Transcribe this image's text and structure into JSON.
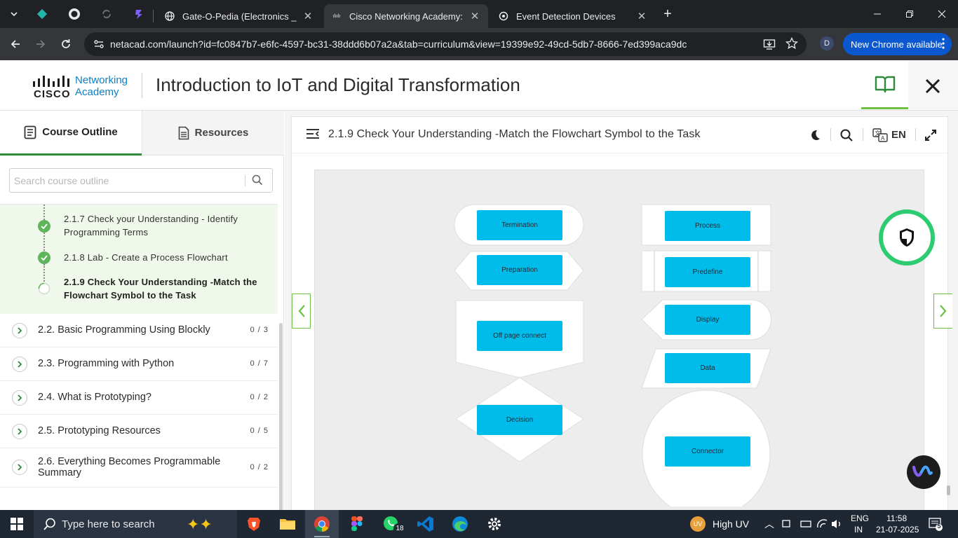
{
  "browser": {
    "tabs": [
      {
        "title": "Gate-O-Pedia (Electronics _ Con",
        "active": false
      },
      {
        "title": "Cisco Networking Academy: Intr",
        "active": true
      },
      {
        "title": "Event Detection Devices",
        "active": false
      }
    ],
    "url": "netacad.com/launch?id=fc0847b7-e6fc-4597-bc31-38ddd6b07a2a&tab=curriculum&view=19399e92-49cd-5db7-8666-7ed399aca9dc",
    "profile_initial": "D",
    "update_button": "New Chrome available"
  },
  "header": {
    "logo_brand": "CISCO",
    "logo_line1": "Networking",
    "logo_line2": "Academy",
    "course_title": "Introduction to IoT and Digital Transformation"
  },
  "sidebar": {
    "tabs": {
      "outline": "Course Outline",
      "resources": "Resources"
    },
    "search_placeholder": "Search course outline",
    "sub_items": [
      {
        "label": "2.1.7 Check your Understanding - Identify Programming Terms",
        "status": "complete"
      },
      {
        "label": "2.1.8 Lab - Create a Process Flowchart",
        "status": "complete"
      },
      {
        "label": "2.1.9 Check Your Understanding -Match the Flowchart Symbol to the Task",
        "status": "current"
      }
    ],
    "sections": [
      {
        "label": "2.2. Basic Programming Using Blockly",
        "count": "0 / 3"
      },
      {
        "label": "2.3. Programming with Python",
        "count": "0 / 7"
      },
      {
        "label": "2.4. What is Prototyping?",
        "count": "0 / 2"
      },
      {
        "label": "2.5. Prototyping Resources",
        "count": "0 / 5"
      },
      {
        "label": "2.6. Everything Becomes Programmable Summary",
        "count": "0 / 2"
      }
    ]
  },
  "content": {
    "page_title": "2.1.9 Check Your Understanding -Match the Flowchart Symbol to the Task",
    "language": "EN",
    "flowchart": {
      "left_labels": [
        "Termination",
        "Preparation",
        "Off page connect",
        "Decision"
      ],
      "right_labels": [
        "Process",
        "Predefine",
        "Display",
        "Data",
        "Connector"
      ],
      "accent_color": "#00bceb"
    }
  },
  "taskbar": {
    "search_placeholder": "Type here to search",
    "whatsapp_badge": "18",
    "weather": "High UV",
    "weather_badge": "UV",
    "lang_line1": "ENG",
    "lang_line2": "IN",
    "time": "11:58",
    "date": "21-07-2025",
    "notification_count": "5"
  },
  "colors": {
    "accent_green": "#6cc04a",
    "cisco_blue": "#0d7fc1",
    "chrome_blue": "#0b57d0"
  }
}
